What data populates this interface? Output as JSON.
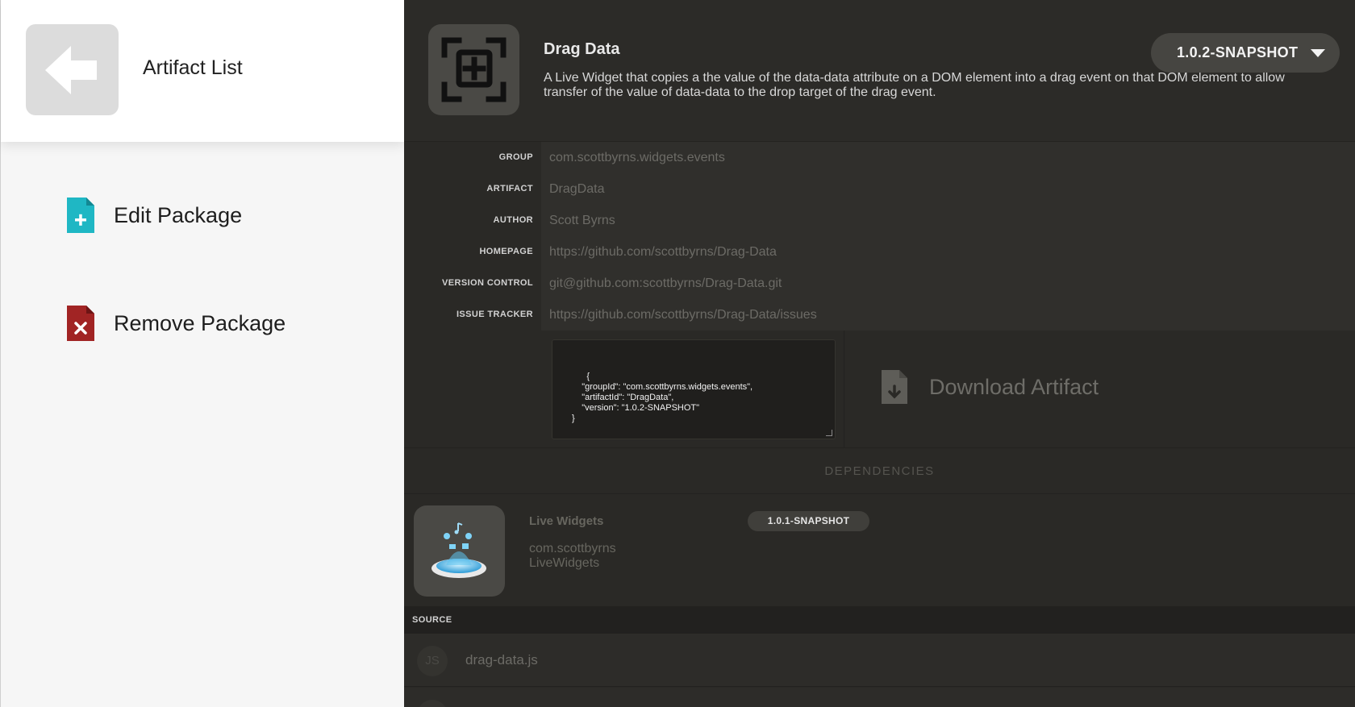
{
  "sidebar": {
    "back_title": "Artifact List",
    "actions": [
      {
        "label": "Edit Package",
        "icon": "file-plus-icon",
        "color": "#1fb7c4"
      },
      {
        "label": "Remove Package",
        "icon": "file-remove-icon",
        "color": "#a12424"
      }
    ]
  },
  "package": {
    "title": "Drag Data",
    "description": "A Live Widget that copies a the value of the data-data attribute on a DOM element into a drag event on that DOM element to allow transfer of the value of data-data to the drop target of the drag event.",
    "version": "1.0.2-SNAPSHOT",
    "icon": "drag-target-icon"
  },
  "meta": [
    {
      "key": "GROUP",
      "value": "com.scottbyrns.widgets.events"
    },
    {
      "key": "ARTIFACT",
      "value": "DragData"
    },
    {
      "key": "AUTHOR",
      "value": "Scott Byrns"
    },
    {
      "key": "HOMEPAGE",
      "value": "https://github.com/scottbyrns/Drag-Data"
    },
    {
      "key": "VERSION CONTROL",
      "value": "git@github.com:scottbyrns/Drag-Data.git"
    },
    {
      "key": "ISSUE TRACKER",
      "value": "https://github.com/scottbyrns/Drag-Data/issues"
    }
  ],
  "code_snippet": "{\n    \"groupId\": \"com.scottbyrns.widgets.events\",\n    \"artifactId\": \"DragData\",\n    \"version\": \"1.0.2-SNAPSHOT\"\n}",
  "download": {
    "label": "Download Artifact",
    "icon": "file-download-icon"
  },
  "dependencies": {
    "header": "DEPENDENCIES",
    "items": [
      {
        "name": "Live Widgets",
        "group": "com.scottbyrns",
        "artifact": "LiveWidgets",
        "version": "1.0.1-SNAPSHOT",
        "icon": "live-widgets-icon"
      }
    ]
  },
  "source": {
    "header": "SOURCE",
    "files": [
      {
        "badge": "JS",
        "name": "drag-data.js"
      },
      {
        "badge": "",
        "name": ""
      }
    ]
  },
  "colors": {
    "accent_edit": "#1fb7c4",
    "accent_remove": "#a12424",
    "panel_dark": "#2a2926"
  }
}
